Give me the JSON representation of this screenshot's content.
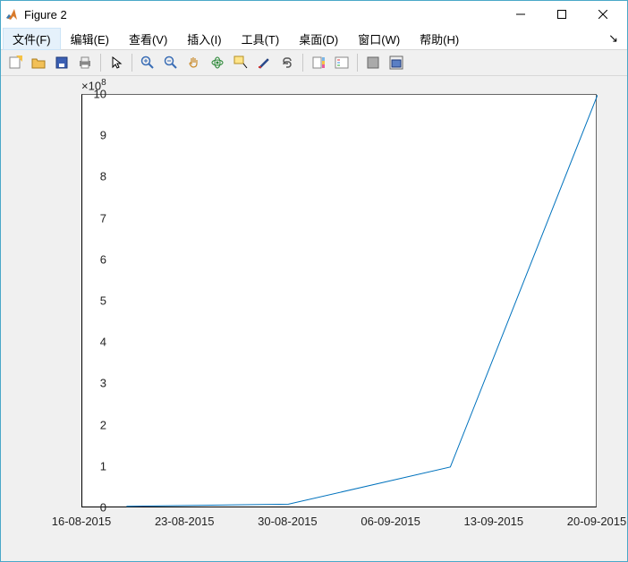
{
  "window": {
    "title": "Figure 2"
  },
  "menu": {
    "items": [
      "文件(F)",
      "编辑(E)",
      "查看(V)",
      "插入(I)",
      "工具(T)",
      "桌面(D)",
      "窗口(W)",
      "帮助(H)"
    ]
  },
  "toolbar_icons": [
    "new-figure-icon",
    "open-icon",
    "save-icon",
    "print-icon",
    "sep",
    "pointer-icon",
    "sep",
    "zoom-in-icon",
    "zoom-out-icon",
    "pan-icon",
    "rotate3d-icon",
    "data-cursor-icon",
    "brush-icon",
    "link-plot-icon",
    "sep",
    "colorbar-icon",
    "legend-icon",
    "sep",
    "hide-tools-icon",
    "dock-icon"
  ],
  "chart_data": {
    "type": "line",
    "y_exponent_label": "×10",
    "y_exponent_sup": "8",
    "ylim": [
      0,
      1000000000
    ],
    "y_tick_values": [
      0,
      1,
      2,
      3,
      4,
      5,
      6,
      7,
      8,
      9,
      10
    ],
    "x_tick_labels": [
      "16-08-2015",
      "23-08-2015",
      "30-08-2015",
      "06-09-2015",
      "13-09-2015",
      "20-09-2015"
    ],
    "points": [
      {
        "x": "19-08-2015",
        "y": 5000000
      },
      {
        "x": "30-08-2015",
        "y": 10000000
      },
      {
        "x": "10-09-2015",
        "y": 100000000
      },
      {
        "x": "20-09-2015",
        "y": 1000000000
      }
    ],
    "line_color": "#0072BD"
  }
}
